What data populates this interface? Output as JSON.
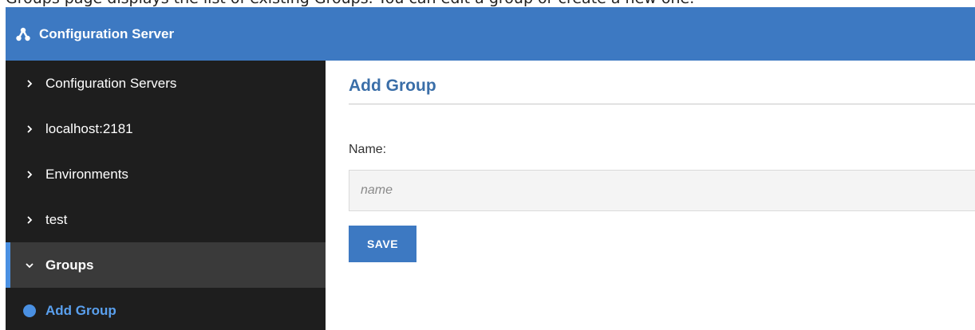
{
  "top_clip_text": "Groups page displays the list of existing Groups. You can edit a group or create a new one.",
  "header": {
    "title": "Configuration Server",
    "logo_icon": "network-icon"
  },
  "sidebar": {
    "items": [
      {
        "label": "Configuration Servers",
        "state": "collapsed"
      },
      {
        "label": "localhost:2181",
        "state": "collapsed"
      },
      {
        "label": "Environments",
        "state": "collapsed"
      },
      {
        "label": "test",
        "state": "collapsed"
      },
      {
        "label": "Groups",
        "state": "expanded"
      }
    ],
    "sub_item": {
      "label": "Add Group"
    }
  },
  "main": {
    "title": "Add Group",
    "name_label": "Name:",
    "name_placeholder": "name",
    "name_value": "",
    "save_label": "SAVE"
  },
  "colors": {
    "header_bg": "#3d79c2",
    "sidebar_bg": "#1e1e1e",
    "active_item_bg": "#3a3a3a",
    "accent": "#4a90e2",
    "sub_item_text": "#5aa0ee",
    "title_text": "#3a6ea8",
    "button_bg": "#3d79c2"
  }
}
